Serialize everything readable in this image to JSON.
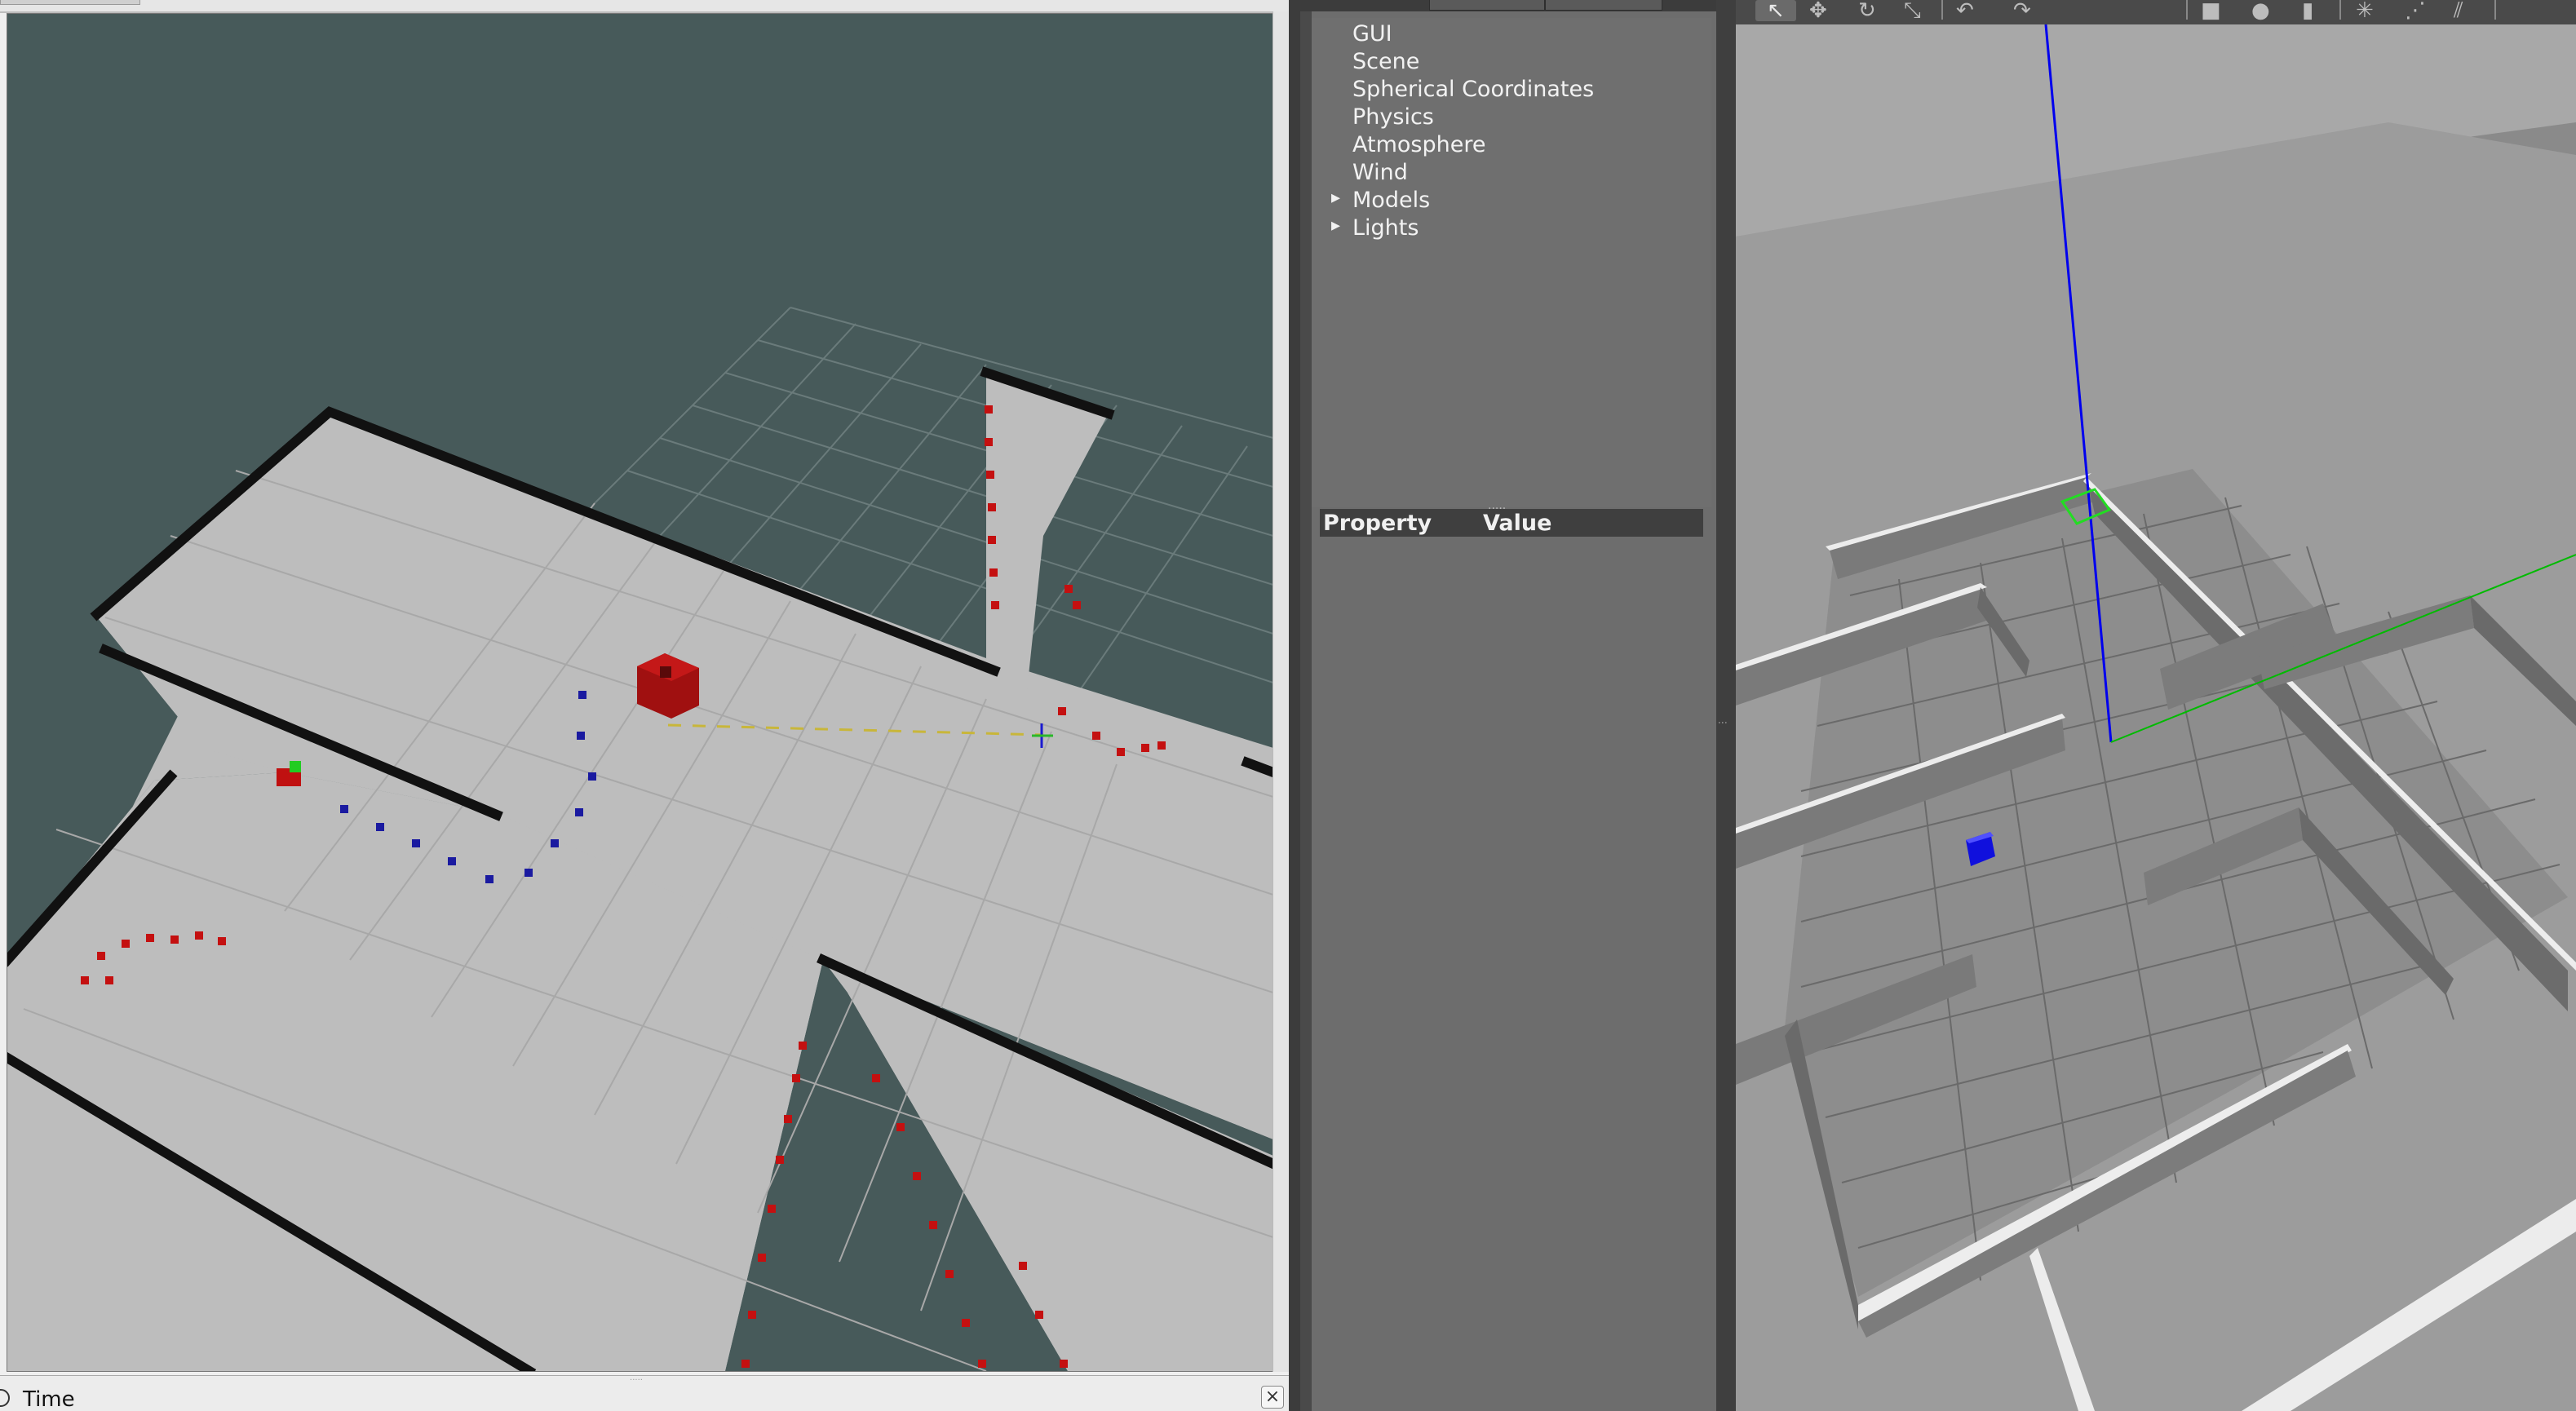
{
  "time_panel": {
    "title": "Time",
    "close_icon": "close-icon",
    "time_icon": "clock-icon"
  },
  "world_tree": {
    "items": [
      {
        "label": "GUI",
        "expandable": false
      },
      {
        "label": "Scene",
        "expandable": false
      },
      {
        "label": "Spherical Coordinates",
        "expandable": false
      },
      {
        "label": "Physics",
        "expandable": false
      },
      {
        "label": "Atmosphere",
        "expandable": false
      },
      {
        "label": "Wind",
        "expandable": false
      },
      {
        "label": "Models",
        "expandable": true
      },
      {
        "label": "Lights",
        "expandable": true
      }
    ]
  },
  "property_table": {
    "col_property": "Property",
    "col_value": "Value"
  },
  "toolbar": {
    "tools": [
      "select-icon",
      "translate-icon",
      "rotate-icon",
      "scale-icon",
      "undo-icon",
      "redo-icon",
      "box-icon",
      "sphere-icon",
      "cylinder-icon",
      "point-light-icon",
      "spot-light-icon",
      "directional-light-icon"
    ]
  },
  "colors": {
    "rviz_background": "#475a5a",
    "map_free": "#bdbdbd",
    "map_wall": "#111111",
    "laser_points": "#c41010",
    "path_points": "#1a1aa0",
    "robot": "#a01010",
    "gazebo_floor": "#8e8e8e",
    "gazebo_wall": "#b8b8b8",
    "z_axis": "#0000ee",
    "y_axis": "#00bb00",
    "robot_box": "#1010dd"
  }
}
